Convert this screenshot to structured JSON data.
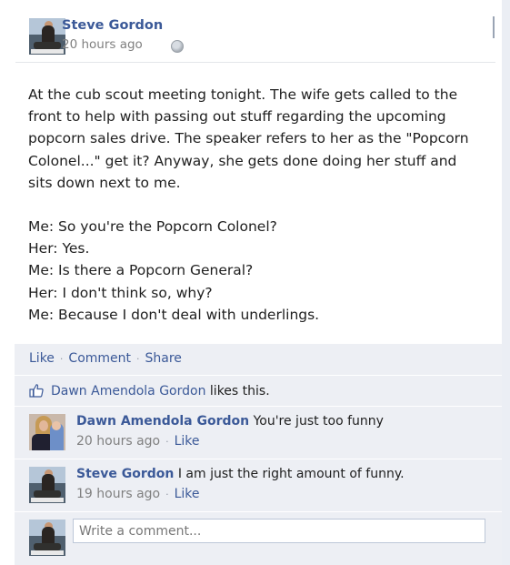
{
  "post": {
    "author": "Steve Gordon",
    "time": "20 hours ago",
    "privacy_icon": "globe-icon",
    "paragraphs": [
      "At the cub scout meeting tonight. The wife gets called to the front to help with passing out stuff regarding the upcoming popcorn sales drive. The speaker refers to her as the \"Popcorn Colonel...\" get it? Anyway, she gets done doing her stuff and sits down next to me."
    ],
    "dialogue": [
      "Me: So you're the Popcorn Colonel?",
      "Her: Yes.",
      "Me: Is there a Popcorn General?",
      "Her: I don't think so, why?",
      "Me: Because I don't deal with underlings."
    ]
  },
  "actions": {
    "like": "Like",
    "comment": "Comment",
    "share": "Share",
    "separator": "·"
  },
  "likes": {
    "icon": "thumbs-up-icon",
    "person": "Dawn Amendola Gordon",
    "suffix": " likes this."
  },
  "comments": [
    {
      "author": "Dawn Amendola Gordon",
      "text": "You're just too funny",
      "time": "20 hours ago",
      "like": "Like"
    },
    {
      "author": "Steve Gordon",
      "text": "I am just the right amount of funny.",
      "time": "19 hours ago",
      "like": "Like"
    }
  ],
  "composer": {
    "placeholder": "Write a comment..."
  },
  "colors": {
    "link": "#3b5998",
    "panel": "#edeff4",
    "meta": "#808080"
  }
}
